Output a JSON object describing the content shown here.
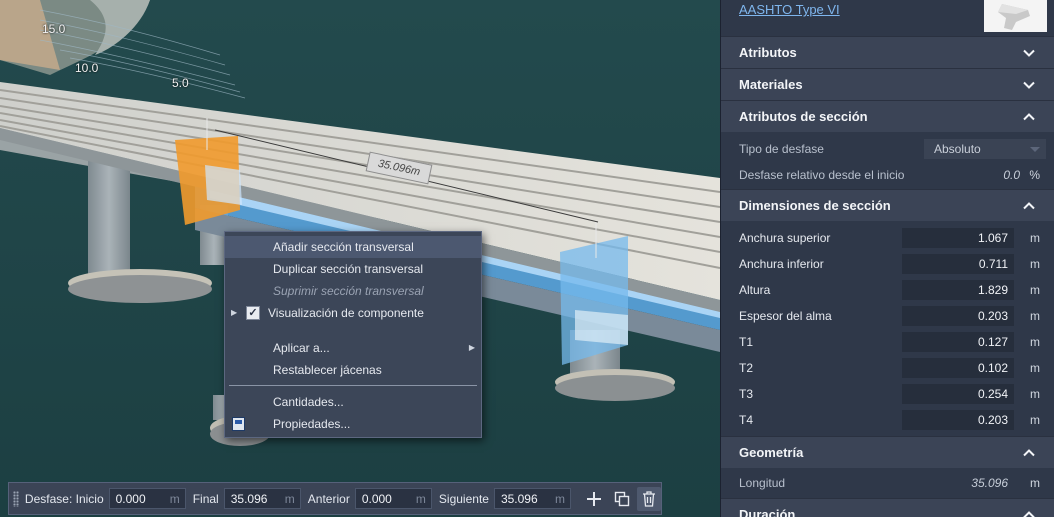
{
  "viewport": {
    "labels": [
      "15.0",
      "10.0",
      "5.0"
    ],
    "dimension": "35.096m"
  },
  "context_menu": {
    "items": [
      {
        "label": "Añadir sección transversal"
      },
      {
        "label": "Duplicar sección transversal"
      },
      {
        "label": "Suprimir sección transversal"
      },
      {
        "label": "Visualización de componente"
      },
      {
        "label": "Aplicar a..."
      },
      {
        "label": "Restablecer jácenas"
      },
      {
        "label": "Cantidades..."
      },
      {
        "label": "Propiedades..."
      }
    ]
  },
  "toolbar": {
    "start_label": "Desfase: Inicio",
    "start_value": "0.000",
    "end_label": "Final",
    "end_value": "35.096",
    "prev_label": "Anterior",
    "prev_value": "0.000",
    "next_label": "Siguiente",
    "next_value": "35.096",
    "unit": "m"
  },
  "panel": {
    "family_link": "AASHTO Type VI",
    "sections": {
      "attributes": "Atributos",
      "materials": "Materiales",
      "section_attributes": "Atributos de sección",
      "section_dimensions": "Dimensiones de sección",
      "geometry": "Geometría",
      "duration": "Duración"
    },
    "offset_type_label": "Tipo de desfase",
    "offset_type_value": "Absoluto",
    "relative_offset_label": "Desfase relativo desde el inicio",
    "relative_offset_value": "0.0",
    "relative_offset_unit": "%",
    "dimensions": [
      {
        "label": "Anchura superior",
        "value": "1.067",
        "unit": "m"
      },
      {
        "label": "Anchura inferior",
        "value": "0.711",
        "unit": "m"
      },
      {
        "label": "Altura",
        "value": "1.829",
        "unit": "m"
      },
      {
        "label": "Espesor del alma",
        "value": "0.203",
        "unit": "m"
      },
      {
        "label": "T1",
        "value": "0.127",
        "unit": "m"
      },
      {
        "label": "T2",
        "value": "0.102",
        "unit": "m"
      },
      {
        "label": "T3",
        "value": "0.254",
        "unit": "m"
      },
      {
        "label": "T4",
        "value": "0.203",
        "unit": "m"
      }
    ],
    "length_label": "Longitud",
    "length_value": "35.096",
    "length_unit": "m"
  }
}
